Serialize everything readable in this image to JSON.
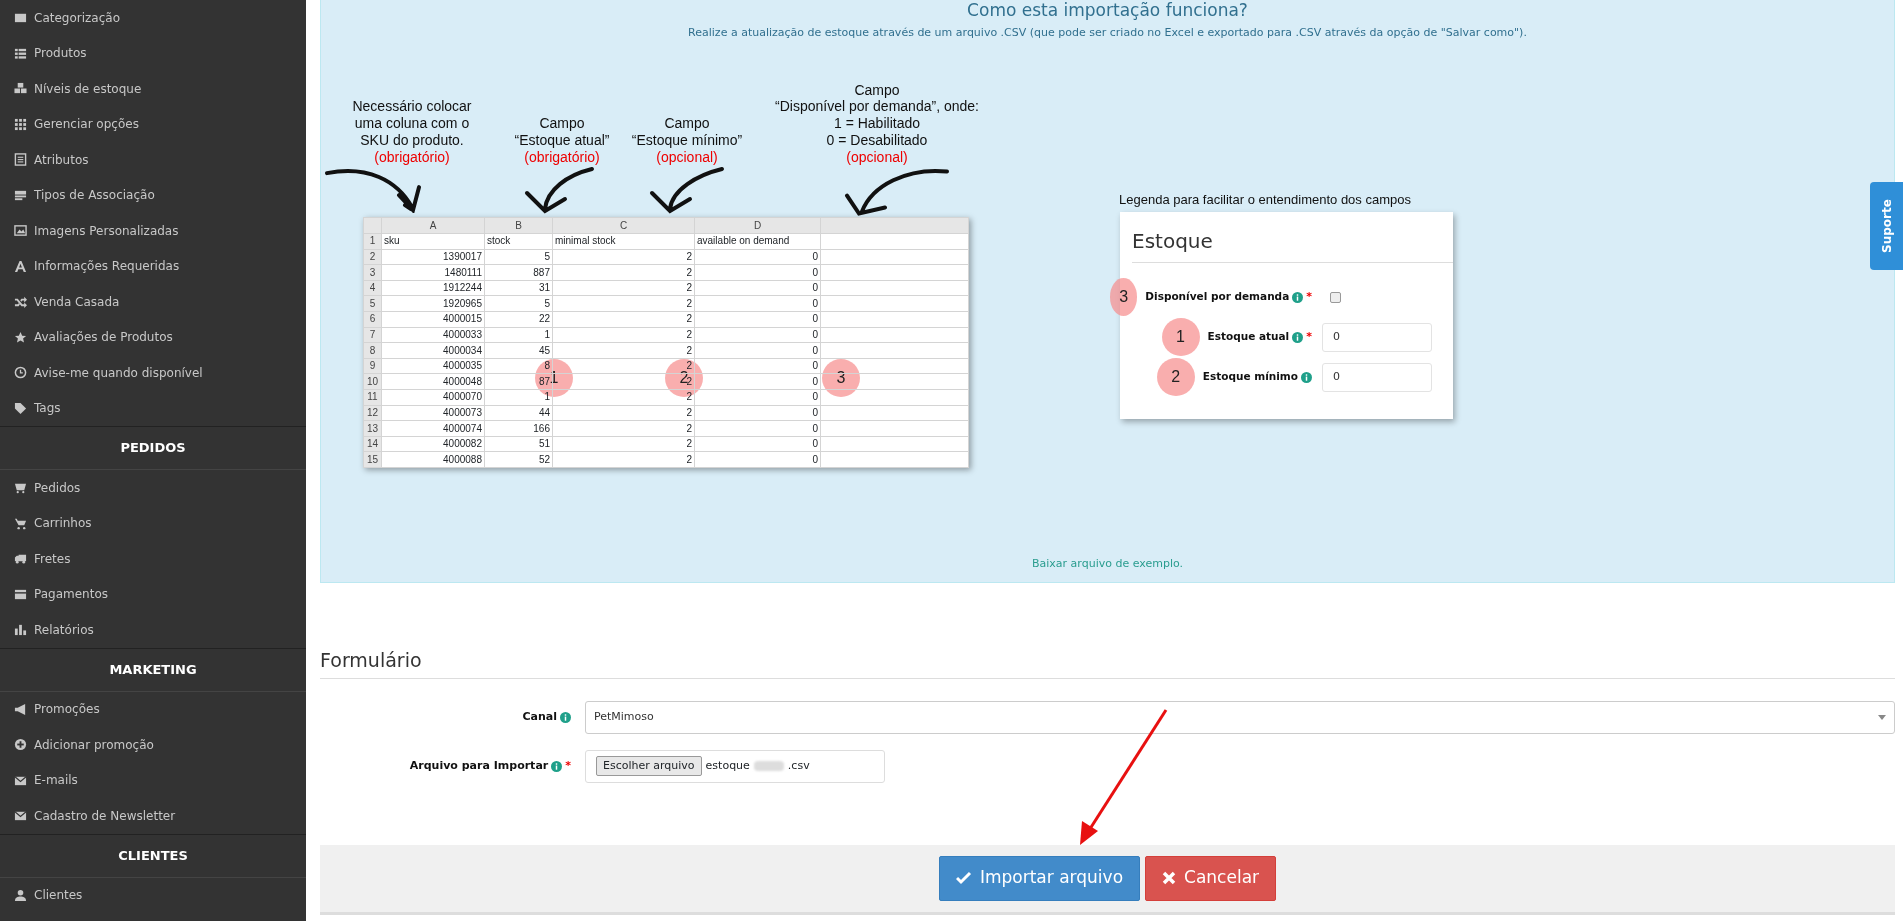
{
  "sidebar": {
    "sections": [
      {
        "items": [
          {
            "label": "Categorização"
          },
          {
            "label": "Produtos"
          },
          {
            "label": "Níveis de estoque"
          },
          {
            "label": "Gerenciar opções"
          },
          {
            "label": "Atributos"
          },
          {
            "label": "Tipos de Associação"
          },
          {
            "label": "Imagens Personalizadas"
          },
          {
            "label": "Informações Requeridas"
          },
          {
            "label": "Venda Casada"
          },
          {
            "label": "Avaliações de Produtos"
          },
          {
            "label": "Avise-me quando disponível"
          },
          {
            "label": "Tags"
          }
        ]
      },
      {
        "heading": "PEDIDOS",
        "items": [
          {
            "label": "Pedidos"
          },
          {
            "label": "Carrinhos"
          },
          {
            "label": "Fretes"
          },
          {
            "label": "Pagamentos"
          },
          {
            "label": "Relatórios"
          }
        ]
      },
      {
        "heading": "MARKETING",
        "items": [
          {
            "label": "Promoções"
          },
          {
            "label": "Adicionar promoção"
          },
          {
            "label": "E-mails"
          },
          {
            "label": "Cadastro de Newsletter"
          }
        ]
      },
      {
        "heading": "CLIENTES",
        "items": [
          {
            "label": "Clientes"
          }
        ]
      }
    ]
  },
  "info_panel": {
    "title": "Como esta importação funciona?",
    "description": "Realize a atualização de estoque através de um arquivo .CSV (que pode ser criado no Excel e exportado para .CSV através da opção de \"Salvar como\").",
    "annotations": [
      {
        "text": "Necessário colocar\numa coluna com o\nSKU do produto.",
        "note": "(obrigatório)"
      },
      {
        "text": "Campo\n“Estoque atual”",
        "note": "(obrigatório)"
      },
      {
        "text": "Campo\n“Estoque mínimo”",
        "note": "(opcional)"
      },
      {
        "text": "Campo\n“Disponível por demanda”, onde:\n1 = Habilitado\n0 = Desabilitado",
        "note": "(opcional)"
      }
    ],
    "spreadsheet": {
      "column_letters": [
        "A",
        "B",
        "C",
        "D"
      ],
      "rows": [
        {
          "n": "1",
          "cells": [
            "sku",
            "stock",
            "minimal stock",
            "available on demand"
          ]
        },
        {
          "n": "2",
          "cells": [
            "1390017",
            "5",
            "2",
            "0"
          ]
        },
        {
          "n": "3",
          "cells": [
            "1480111",
            "887",
            "2",
            "0"
          ]
        },
        {
          "n": "4",
          "cells": [
            "1912244",
            "31",
            "2",
            "0"
          ]
        },
        {
          "n": "5",
          "cells": [
            "1920965",
            "5",
            "2",
            "0"
          ]
        },
        {
          "n": "6",
          "cells": [
            "4000015",
            "22",
            "2",
            "0"
          ]
        },
        {
          "n": "7",
          "cells": [
            "4000033",
            "1",
            "2",
            "0"
          ]
        },
        {
          "n": "8",
          "cells": [
            "4000034",
            "45",
            "2",
            "0"
          ]
        },
        {
          "n": "9",
          "cells": [
            "4000035",
            "8",
            "2",
            "0"
          ]
        },
        {
          "n": "10",
          "cells": [
            "4000048",
            "87",
            "2",
            "0"
          ]
        },
        {
          "n": "11",
          "cells": [
            "4000070",
            "1",
            "2",
            "0"
          ]
        },
        {
          "n": "12",
          "cells": [
            "4000073",
            "44",
            "2",
            "0"
          ]
        },
        {
          "n": "13",
          "cells": [
            "4000074",
            "166",
            "2",
            "0"
          ]
        },
        {
          "n": "14",
          "cells": [
            "4000082",
            "51",
            "2",
            "0"
          ]
        },
        {
          "n": "15",
          "cells": [
            "4000088",
            "52",
            "2",
            "0"
          ]
        }
      ],
      "markers": [
        "1",
        "2",
        "3"
      ]
    },
    "legend": {
      "caption": "Legenda para facilitar o entendimento dos campos",
      "title": "Estoque",
      "fields": [
        {
          "kind": "checkbox",
          "marker": "3",
          "label": "Disponível por demanda",
          "required_mark": "*",
          "checked": false
        },
        {
          "kind": "text",
          "marker": "1",
          "label": "Estoque atual",
          "required_mark": "*",
          "value": "0"
        },
        {
          "kind": "text",
          "marker": "2",
          "label": "Estoque mínimo",
          "value": "0"
        }
      ]
    },
    "download_link": "Baixar arquivo de exemplo."
  },
  "form": {
    "title": "Formulário",
    "fields": [
      {
        "kind": "select",
        "label": "Canal",
        "value": "PetMimoso"
      },
      {
        "kind": "file",
        "label": "Arquivo para Importar",
        "required_mark": "*",
        "button": "Escolher arquivo",
        "file_name": "estoque",
        "file_extension": ".csv"
      }
    ]
  },
  "buttons": [
    {
      "kind": "primary",
      "label": "Importar arquivo"
    },
    {
      "kind": "danger",
      "label": "Cancelar"
    }
  ],
  "support_tab": "Suporte"
}
